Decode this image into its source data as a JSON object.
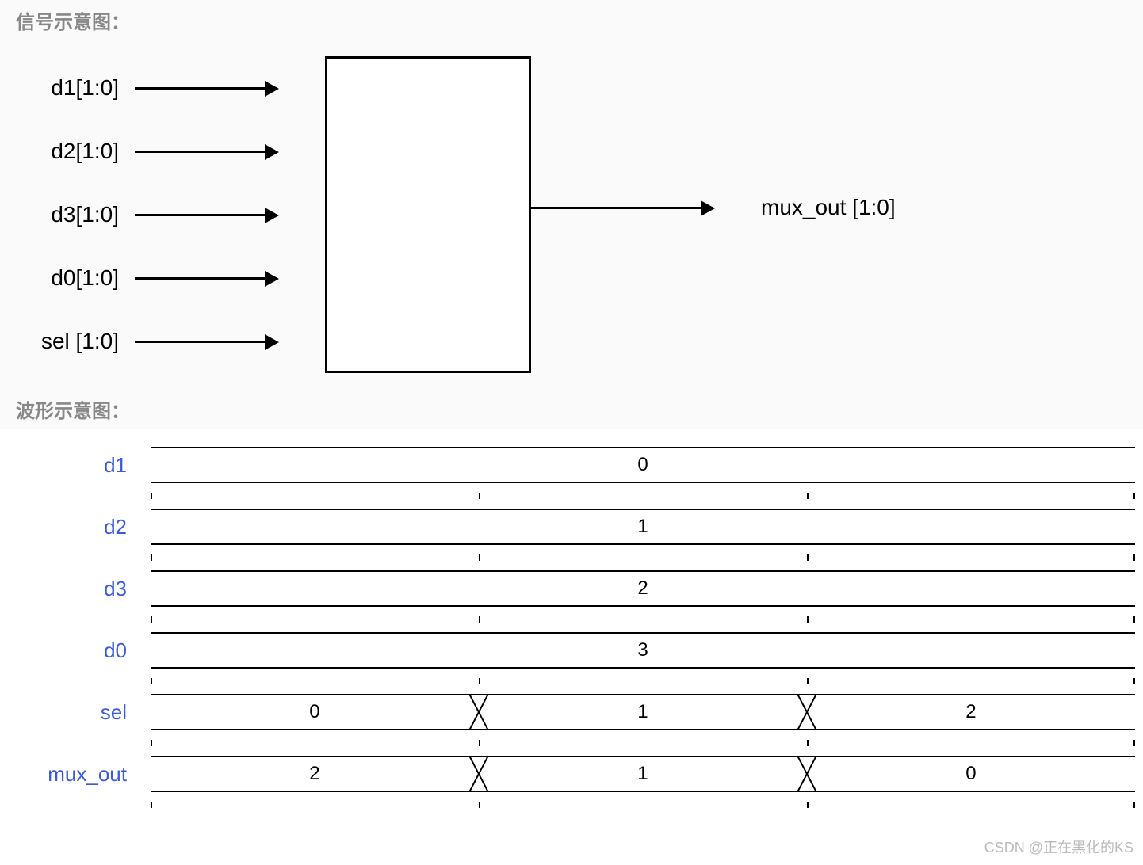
{
  "titles": {
    "block": "信号示意图：",
    "wave": "波形示意图："
  },
  "block": {
    "inputs": [
      "d1[1:0]",
      "d2[1:0]",
      "d3[1:0]",
      "d0[1:0]",
      "sel [1:0]"
    ],
    "output": "mux_out [1:0]"
  },
  "waveform": {
    "constant_signals": [
      {
        "name": "d1",
        "value": "0"
      },
      {
        "name": "d2",
        "value": "1"
      },
      {
        "name": "d3",
        "value": "2"
      },
      {
        "name": "d0",
        "value": "3"
      }
    ],
    "varying_signals": [
      {
        "name": "sel",
        "segments": [
          "0",
          "1",
          "2"
        ]
      },
      {
        "name": "mux_out",
        "segments": [
          "2",
          "1",
          "0"
        ]
      }
    ]
  },
  "watermark": "CSDN @正在黑化的KS",
  "chart_data": {
    "type": "table",
    "title": "4-to-1 2-bit multiplexer — block and timing diagram",
    "block_diagram": {
      "inputs": [
        "d0[1:0]",
        "d1[1:0]",
        "d2[1:0]",
        "d3[1:0]",
        "sel[1:0]"
      ],
      "output": "mux_out[1:0]"
    },
    "timing": {
      "time_slots": [
        0,
        1,
        2
      ],
      "signals": {
        "d1": [
          0,
          0,
          0
        ],
        "d2": [
          1,
          1,
          1
        ],
        "d3": [
          2,
          2,
          2
        ],
        "d0": [
          3,
          3,
          3
        ],
        "sel": [
          0,
          1,
          2
        ],
        "mux_out": [
          2,
          1,
          0
        ]
      }
    }
  }
}
